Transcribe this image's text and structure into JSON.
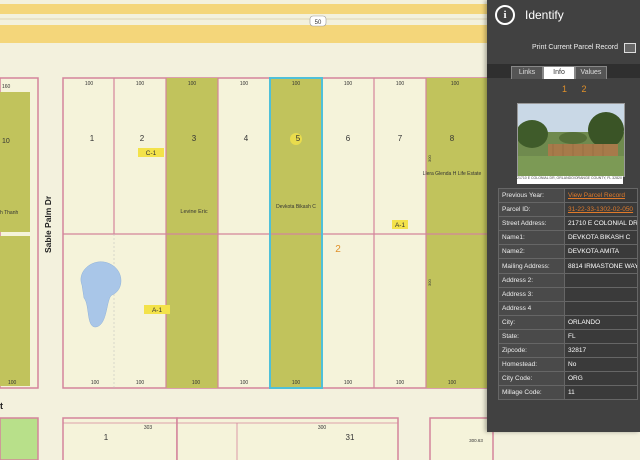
{
  "map": {
    "street_label": "Sable Palm Dr",
    "street_partial": "t",
    "road_shield": "50",
    "lots_top_row": [
      {
        "number": "1",
        "frontage_top": "100",
        "frontage_bottom": "100",
        "zoned": false
      },
      {
        "number": "2",
        "frontage_top": "100",
        "frontage_bottom": "100",
        "zoned": false
      },
      {
        "number": "3",
        "frontage_top": "100",
        "frontage_bottom": "100",
        "zoned": true
      },
      {
        "number": "4",
        "frontage_top": "100",
        "frontage_bottom": "100",
        "zoned": false
      },
      {
        "number": "5",
        "frontage_top": "100",
        "frontage_bottom": "100",
        "zoned": true
      },
      {
        "number": "6",
        "frontage_top": "100",
        "frontage_bottom": "100",
        "zoned": false
      },
      {
        "number": "7",
        "frontage_top": "100",
        "frontage_bottom": "100",
        "zoned": false
      },
      {
        "number": "8",
        "frontage_top": "100",
        "frontage_bottom": "100",
        "zoned": true
      }
    ],
    "left_lot_number": "10",
    "left_lot_top": "160",
    "left_lot_bottom": "100",
    "owner_labels": {
      "lot3": "Levine Eric",
      "lot5": "Devkota Bikash C",
      "lot8": "Llera Glenda H Life Estate",
      "left": "h Thanh"
    },
    "zoning_labels": [
      "C-1",
      "A-1",
      "A-1"
    ],
    "block_number": "2",
    "lot_depth_label": "300",
    "bottom_row": {
      "lot_left": "1",
      "lot_right": "31",
      "frontage_left": "303",
      "frontage_right": "300",
      "right_side": "300.63"
    }
  },
  "panel": {
    "title": "Identify",
    "print_label": "Print Current Parcel Record",
    "tabs": [
      "Links",
      "Info",
      "Values"
    ],
    "active_tab": "Info",
    "pages": "1 2",
    "photo_caption": "21710 E COLONIAL DR, ORLANDO/ORANGE COUNTY, FL 32820 - PARCEL 31-22-33-1302-02-050",
    "attributes": [
      {
        "key": "Previous Year:",
        "value": "View Parcel Record",
        "link": true
      },
      {
        "key": "Parcel ID:",
        "value": "31-22-33-1302-02-050",
        "link": true
      },
      {
        "key": "Street Address:",
        "value": "21710 E COLONIAL DR",
        "link": false
      },
      {
        "key": "Name1:",
        "value": "DEVKOTA BIKASH C",
        "link": false
      },
      {
        "key": "Name2:",
        "value": "DEVKOTA AMITA",
        "link": false
      },
      {
        "key": "Mailing Address:",
        "value": "8814 IRMASTONE WAY",
        "link": false
      },
      {
        "key": "Address 2:",
        "value": "",
        "link": false
      },
      {
        "key": "Address 3:",
        "value": "",
        "link": false
      },
      {
        "key": "Address 4",
        "value": "",
        "link": false
      },
      {
        "key": "City:",
        "value": "ORLANDO",
        "link": false
      },
      {
        "key": "State:",
        "value": "FL",
        "link": false
      },
      {
        "key": "Zipcode:",
        "value": "32817",
        "link": false
      },
      {
        "key": "Homestead:",
        "value": "No",
        "link": false
      },
      {
        "key": "City Code:",
        "value": "ORG",
        "link": false
      },
      {
        "key": "Millage Code:",
        "value": "11",
        "link": false
      }
    ]
  },
  "colors": {
    "lot_fill": "#f5f3da",
    "zoned_fill": "#c1c35c",
    "lot_border": "#d4849b",
    "selected_border": "#4fc0d8",
    "road": "#f4d67a",
    "panel_bg": "#414141",
    "accent_orange": "#e07a2a"
  }
}
